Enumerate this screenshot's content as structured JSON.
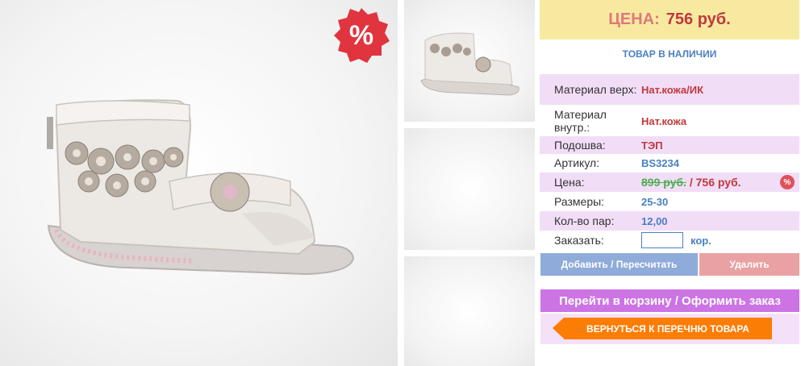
{
  "price_header": {
    "label": "ЦЕНА:",
    "value": "756 руб."
  },
  "stock_status": "ТОВАР В НАЛИЧИИ",
  "sale_badge": "%",
  "specs": [
    {
      "key": "Материал верх:",
      "value": "Нат.кожа/ИК"
    },
    {
      "key": "Материал внутр.:",
      "value": "Нат.кожа"
    },
    {
      "key": "Подошва:",
      "value": "ТЭП"
    },
    {
      "key": "Артикул:",
      "value": "BS3234"
    }
  ],
  "price_row": {
    "key": "Цена:",
    "old": "899 руб.",
    "sep": " / ",
    "new": "756 руб.",
    "badge": "%"
  },
  "sizes": {
    "key": "Размеры:",
    "value": "25-30"
  },
  "pairs": {
    "key": "Кол-во пар:",
    "value": "12,00"
  },
  "order": {
    "key": "Заказать:",
    "input_value": "",
    "unit": "кор."
  },
  "buttons": {
    "add": "Добавить / Пересчитать",
    "delete": "Удалить",
    "cart": "Перейти в корзину / Оформить заказ",
    "back": "ВЕРНУТЬСЯ К ПЕРЕЧНЮ ТОВАРА"
  },
  "colors": {
    "price_bg": "#f7eaa0",
    "accent_red": "#c0393e",
    "accent_blue": "#4a7fc1",
    "row_pink": "#f2ddf7",
    "add_btn": "#8fabd9",
    "del_btn": "#e9a1a3",
    "cart_btn": "#cc74e4",
    "back_btn": "#fc7d05"
  }
}
